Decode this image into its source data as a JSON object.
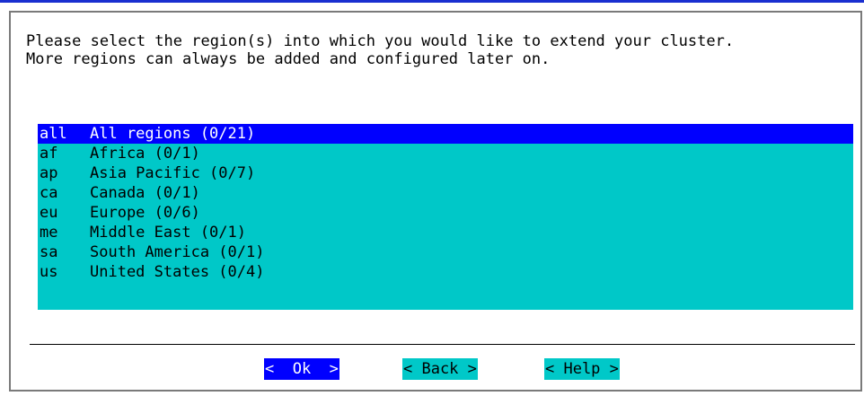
{
  "prompt": {
    "line1": "Please select the region(s) into which you would like to extend your cluster.",
    "line2": "More regions can always be added and configured later on."
  },
  "regions": [
    {
      "code": "all",
      "label": "All regions (0/21)",
      "selected": true
    },
    {
      "code": "af",
      "label": "Africa (0/1)"
    },
    {
      "code": "ap",
      "label": "Asia Pacific (0/7)"
    },
    {
      "code": "ca",
      "label": "Canada (0/1)"
    },
    {
      "code": "eu",
      "label": "Europe (0/6)"
    },
    {
      "code": "me",
      "label": "Middle East (0/1)"
    },
    {
      "code": "sa",
      "label": "South America (0/1)"
    },
    {
      "code": "us",
      "label": "United States (0/4)"
    }
  ],
  "buttons": {
    "ok": "<  Ok  >",
    "back": "< Back >",
    "help": "< Help >"
  },
  "colors": {
    "list_background": "#00c8c8",
    "selection": "#0000ff",
    "top_border": "#1a2fd0"
  }
}
